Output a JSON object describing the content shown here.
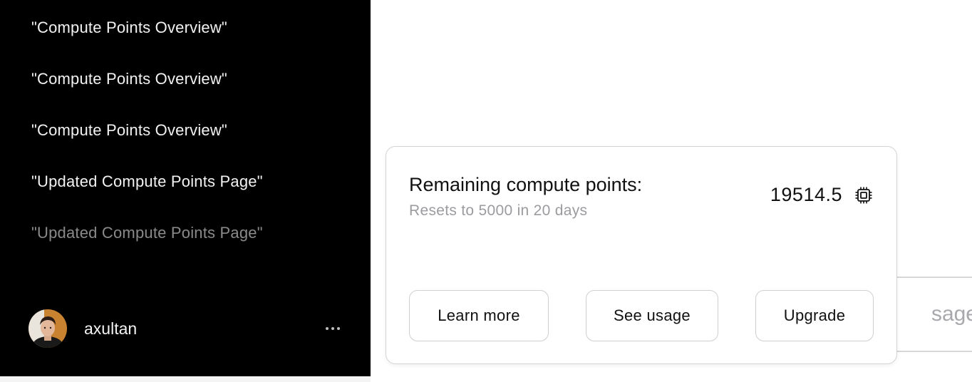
{
  "sidebar": {
    "chats": [
      {
        "label": "\"Compute Points Overview\""
      },
      {
        "label": "\"Compute Points Overview\""
      },
      {
        "label": "\"Compute Points Overview\""
      },
      {
        "label": "\"Updated Compute Points Page\""
      },
      {
        "label": "\"Updated Compute Points Page\""
      }
    ],
    "user": {
      "name": "axultan",
      "avatar_icon": "user-avatar-photo",
      "more_icon": "ellipsis-icon"
    }
  },
  "background": {
    "usage_button_partial_label": "sage"
  },
  "compute_card": {
    "title": "Remaining compute points:",
    "subtitle": "Resets to 5000 in 20 days",
    "points_value": "19514.5",
    "points_icon": "cpu-chip-icon",
    "buttons": {
      "learn_more": "Learn more",
      "see_usage": "See usage",
      "upgrade": "Upgrade"
    }
  },
  "colors": {
    "sidebar_bg": "#000000",
    "sidebar_text": "#f2f2f2",
    "sidebar_text_faded": "#8a8a8a",
    "card_border": "#d4d4d4",
    "subtitle_text": "#9b9ba0"
  }
}
